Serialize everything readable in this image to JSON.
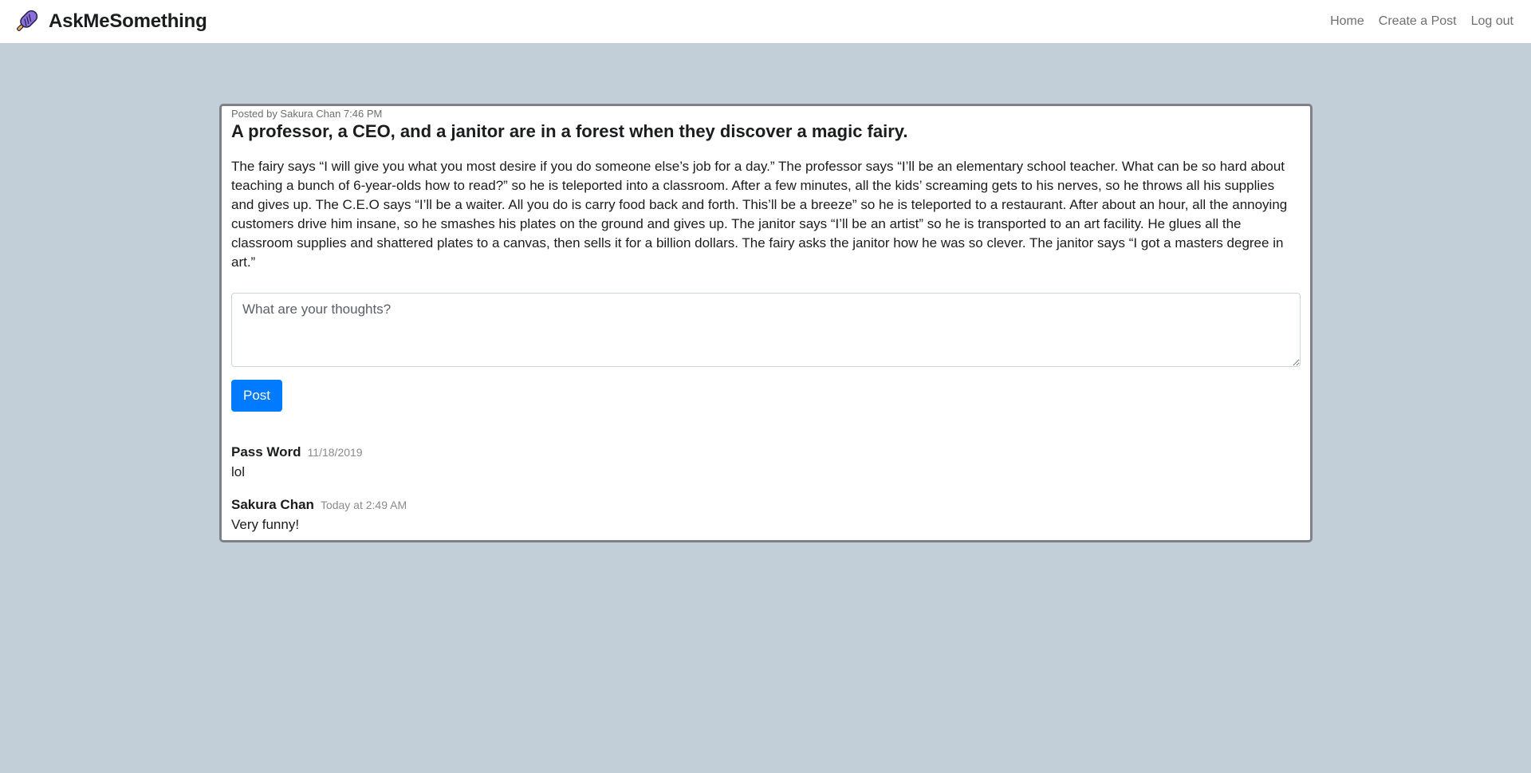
{
  "app": {
    "name": "AskMeSomething",
    "logo_icon": "popsicle-icon"
  },
  "nav": {
    "links": [
      {
        "label": "Home"
      },
      {
        "label": "Create a Post"
      },
      {
        "label": "Log out"
      }
    ]
  },
  "post": {
    "meta": "Posted by Sakura Chan 7:46 PM",
    "title": "A professor, a CEO, and a janitor are in a forest when they discover a magic fairy.",
    "body": "The fairy says “I will give you what you most desire if you do someone else’s job for a day.” The professor says “I’ll be an elementary school teacher. What can be so hard about teaching a bunch of 6-year-olds how to read?” so he is teleported into a classroom. After a few minutes, all the kids’ screaming gets to his nerves, so he throws all his supplies and gives up. The C.E.O says “I’ll be a waiter. All you do is carry food back and forth. This’ll be a breeze” so he is teleported to a restaurant. After about an hour, all the annoying customers drive him insane, so he smashes his plates on the ground and gives up. The janitor says “I’ll be an artist” so he is transported to an art facility. He glues all the classroom supplies and shattered plates to a canvas, then sells it for a billion dollars. The fairy asks the janitor how he was so clever. The janitor says “I got a masters degree in art.”"
  },
  "comment_form": {
    "placeholder": "What are your thoughts?",
    "value": "",
    "submit_label": "Post"
  },
  "comments": [
    {
      "author": "Pass Word",
      "date": "11/18/2019",
      "text": "lol"
    },
    {
      "author": "Sakura Chan",
      "date": "Today at 2:49 AM",
      "text": "Very funny!"
    }
  ],
  "colors": {
    "background": "#c2cfd9",
    "accent": "#007bff",
    "logo": "#8b6fe0"
  }
}
